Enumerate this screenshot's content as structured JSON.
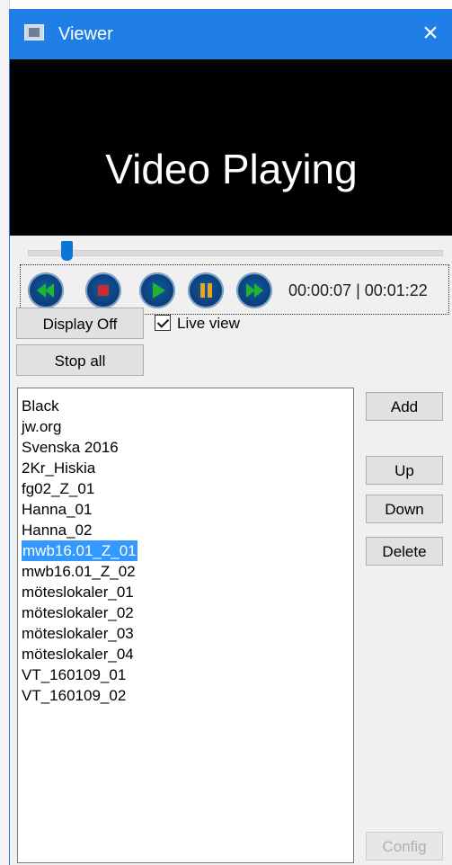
{
  "window": {
    "title": "Viewer",
    "close_icon": "×"
  },
  "video": {
    "status_text": "Video Playing"
  },
  "playback": {
    "progress_fraction": 0.09,
    "time_text": "00:00:07 | 00:01:22"
  },
  "transport": {
    "rewind": "rewind-icon",
    "stop": "stop-icon",
    "play": "play-icon",
    "pause": "pause-icon",
    "fast_forward": "fast-forward-icon"
  },
  "controls": {
    "display_off_label": "Display Off",
    "live_view_label": "Live view",
    "live_view_checked": true,
    "stop_all_label": "Stop all"
  },
  "playlist": {
    "items": [
      "Black",
      "jw.org",
      "Svenska 2016",
      "2Kr_Hiskia",
      "fg02_Z_01",
      "Hanna_01",
      "Hanna_02",
      "mwb16.01_Z_01",
      "mwb16.01_Z_02",
      "möteslokaler_01",
      "möteslokaler_02",
      "möteslokaler_03",
      "möteslokaler_04",
      "VT_160109_01",
      "VT_160109_02"
    ],
    "selected_index": 7
  },
  "side_buttons": {
    "add_label": "Add",
    "up_label": "Up",
    "down_label": "Down",
    "delete_label": "Delete",
    "config_label": "Config"
  },
  "colors": {
    "title_bar": "#1f7fe6",
    "selection": "#3399ff",
    "transport_red": "#d12a2a",
    "transport_green": "#1fb52d",
    "transport_orange": "#f0a21a"
  }
}
